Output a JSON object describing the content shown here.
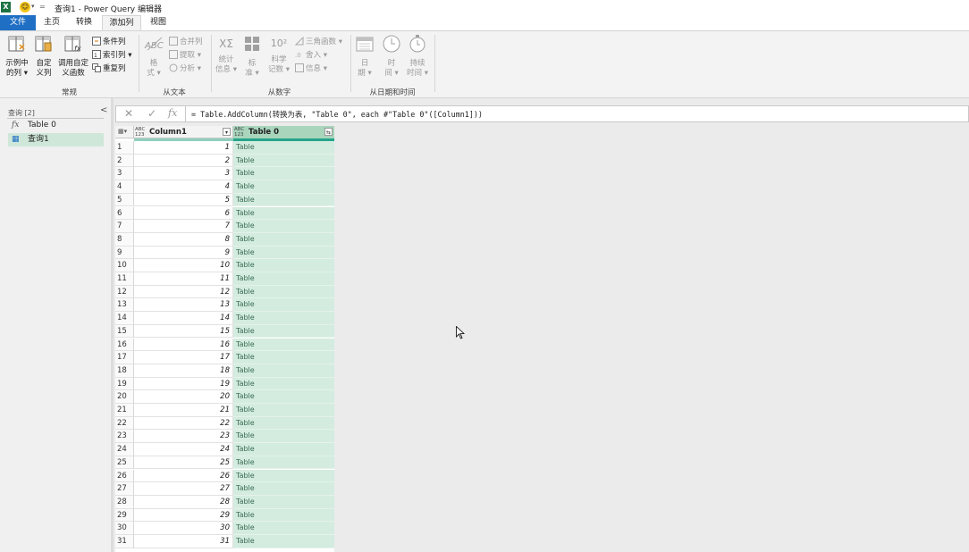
{
  "window": {
    "title": "查询1 - Power Query 编辑器",
    "app_icon_letter": "X",
    "qat_dropdown_glyph": "▾",
    "qat_customize_glyph": "="
  },
  "tabs": [
    {
      "label": "文件"
    },
    {
      "label": "主页"
    },
    {
      "label": "转换"
    },
    {
      "label": "添加列"
    },
    {
      "label": "视图"
    }
  ],
  "ribbon": {
    "general": {
      "label": "常规",
      "example_col": [
        "示例中",
        "的列 ▾"
      ],
      "custom_col": [
        "自定",
        "义列"
      ],
      "invoke_fn": [
        "调用自定",
        "义函数"
      ],
      "conditional_col": "条件列",
      "index_col": "索引列 ▾",
      "duplicate_col": "重复列"
    },
    "from_text": {
      "label": "从文本",
      "format": [
        "格",
        "式 ▾"
      ],
      "merge_cols": "合并列",
      "extract": "提取 ▾",
      "parse": "分析 ▾"
    },
    "from_number": {
      "label": "从数字",
      "statistics": [
        "统计",
        "信息 ▾"
      ],
      "standard": [
        "标",
        "准 ▾"
      ],
      "scientific": [
        "科学",
        "记数 ▾"
      ],
      "trig": "三角函数 ▾",
      "rounding": "舍入 ▾",
      "information": "信息 ▾",
      "sci_icon_text": "10²",
      "stat_icon_text": "XΣ"
    },
    "from_datetime": {
      "label": "从日期和时间",
      "date": [
        "日",
        "期 ▾"
      ],
      "time": [
        "时",
        "间 ▾"
      ],
      "duration": [
        "持续",
        "时间 ▾"
      ]
    }
  },
  "queries_pane": {
    "header": "查询 [2]",
    "collapse_glyph": "<",
    "items": [
      {
        "icon": "fx",
        "label": "Table 0",
        "selected": false
      },
      {
        "icon": "▦",
        "label": "查询1",
        "selected": true
      }
    ]
  },
  "formula_bar": {
    "cancel_glyph": "✕",
    "commit_glyph": "✓",
    "fx_glyph": "fx",
    "formula": "= Table.AddColumn(转换为表, \"Table 0\", each #\"Table 0\"([Column1]))"
  },
  "grid": {
    "corner_glyph": "▦▾",
    "columns": [
      {
        "name": "Column1",
        "type_label": "ABC\n123",
        "filter_glyph": "▾"
      },
      {
        "name": "Table 0",
        "type_label": "ABC\n123",
        "filter_glyph": "⇆"
      }
    ],
    "cell_text": "Table",
    "rows": [
      1,
      2,
      3,
      4,
      5,
      6,
      7,
      8,
      9,
      10,
      11,
      12,
      13,
      14,
      15,
      16,
      17,
      18,
      19,
      20,
      21,
      22,
      23,
      24,
      25,
      26,
      27,
      28,
      29,
      30,
      31
    ]
  },
  "colors": {
    "file_tab": "#1f6fc5",
    "selected_col_bg": "#d3ecdf",
    "selected_col_header": "#a8d5bc",
    "quality_bar": "#26a48a",
    "selected_query": "#cfe7d9"
  }
}
